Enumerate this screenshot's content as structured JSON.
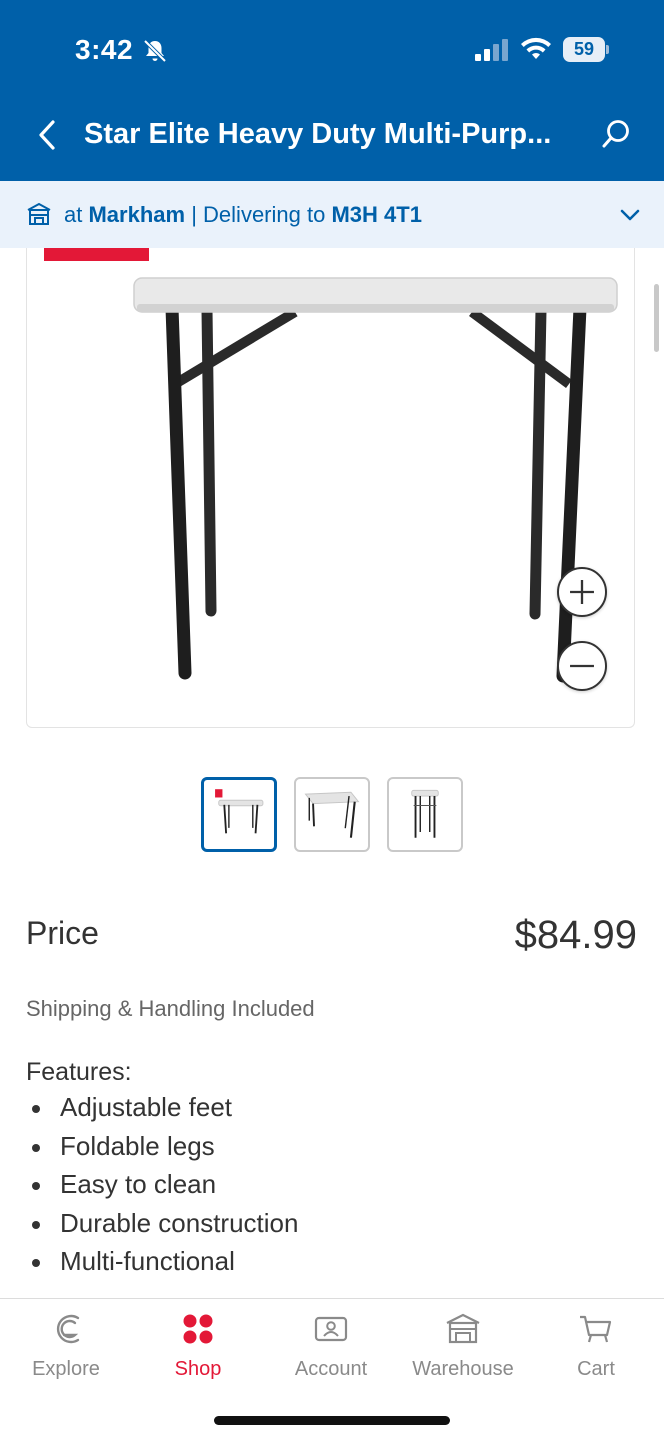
{
  "status_bar": {
    "time": "3:42",
    "battery": "59"
  },
  "header": {
    "title": "Star Elite Heavy Duty Multi-Purp..."
  },
  "location": {
    "prefix": "at",
    "store": "Markham",
    "separator": "|",
    "delivering_label": "Delivering to",
    "postal_code": "M3H 4T1"
  },
  "product": {
    "price_label": "Price",
    "price": "$84.99",
    "shipping": "Shipping & Handling Included",
    "features_title": "Features:",
    "features": [
      "Adjustable feet",
      "Foldable legs",
      "Easy to clean",
      "Durable construction",
      "Multi-functional"
    ],
    "thumbnails_count": 3,
    "active_thumbnail": 1
  },
  "tabs": [
    {
      "label": "Explore",
      "icon": "explore-icon",
      "active": false
    },
    {
      "label": "Shop",
      "icon": "shop-icon",
      "active": true
    },
    {
      "label": "Account",
      "icon": "account-icon",
      "active": false
    },
    {
      "label": "Warehouse",
      "icon": "warehouse-icon",
      "active": false
    },
    {
      "label": "Cart",
      "icon": "cart-icon",
      "active": false
    }
  ],
  "colors": {
    "brand_blue": "#0060a9",
    "accent_red": "#e31837",
    "location_bg": "#eaf2fb"
  }
}
